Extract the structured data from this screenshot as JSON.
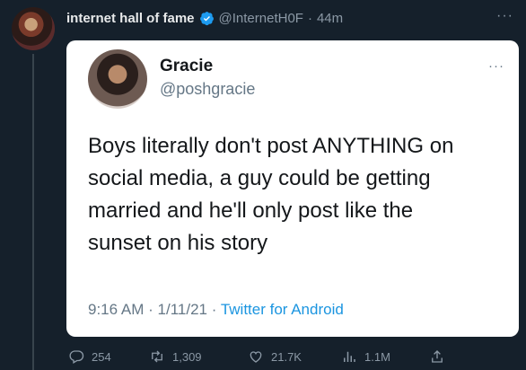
{
  "tweet": {
    "author_name": "internet hall of fame",
    "handle": "@InternetH0F",
    "separator": "·",
    "time": "44m",
    "more": "···"
  },
  "quoted": {
    "name": "Gracie",
    "handle": "@poshgracie",
    "more": "···",
    "text_lines": [
      "Boys literally don't post ANYTHING on",
      "social media, a guy could be getting",
      "married and he'll only post like the",
      "sunset on his story"
    ],
    "time": "9:16 AM",
    "date": "1/11/21",
    "separator": "·",
    "source": "Twitter for Android"
  },
  "actions": {
    "replies": "254",
    "retweets": "1,309",
    "likes": "21.7K",
    "views": "1.1M"
  },
  "colors": {
    "background": "#15202b",
    "verified": "#1d9bf0",
    "source_link": "#1b95e0"
  }
}
